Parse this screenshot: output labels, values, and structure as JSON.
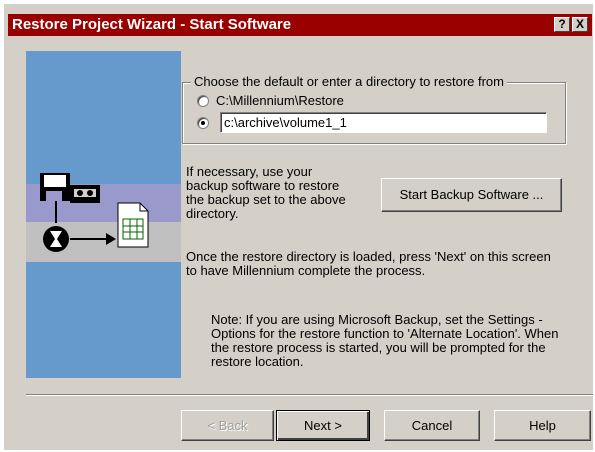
{
  "window": {
    "title": "Restore Project Wizard - Start Software",
    "help_glyph": "?",
    "close_glyph": "X",
    "accent_color": "#990000"
  },
  "restore_source": {
    "legend": "Choose the default or enter a directory to restore from",
    "option_default": "C:\\Millennium\\Restore",
    "option_custom_value": "c:\\archive\\volume1_1",
    "selected": "custom"
  },
  "backup": {
    "instruction_lines": [
      "If necessary, use your",
      "backup software to restore",
      "the backup set to the above",
      "directory."
    ],
    "start_button": "Start Backup Software ..."
  },
  "next_info": {
    "lines": [
      "Once the restore directory is loaded, press 'Next' on this screen",
      "to have Millennium complete the process."
    ]
  },
  "note": {
    "lines": [
      "Note: If you are using Microsoft Backup, set the Settings -",
      "Options for the restore function to 'Alternate Location'. When",
      "the restore process is started, you will be prompted for the",
      "restore location."
    ]
  },
  "buttons": {
    "back": "< Back",
    "next": "Next >",
    "cancel": "Cancel",
    "help": "Help"
  },
  "illustration": {
    "icons": [
      "floppy-disk-icon",
      "tape-cartridge-icon",
      "hourglass-icon",
      "document-icon"
    ]
  }
}
